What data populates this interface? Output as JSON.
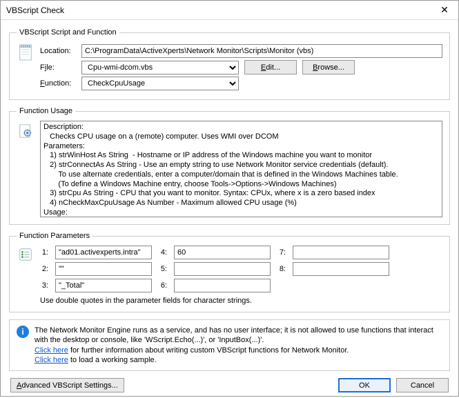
{
  "window": {
    "title": "VBScript Check",
    "close": "✕"
  },
  "scriptFn": {
    "legend": "VBScript Script and Function",
    "locationLabel": "Location:",
    "locationValue": "C:\\ProgramData\\ActiveXperts\\Network Monitor\\Scripts\\Monitor (vbs)",
    "fileLabelPlain": "F",
    "fileLabelUnderline": "i",
    "fileLabelRest": "le:",
    "fileValue": "Cpu-wmi-dcom.vbs",
    "edit": "Edit...",
    "editUnderline": "E",
    "browse": "owse...",
    "browseUnderline": "B",
    "browsePrefix": "r",
    "functionLabelUnderline": "F",
    "functionLabelRest": "unction:",
    "functionValue": "CheckCpuUsage"
  },
  "usage": {
    "legend": "Function Usage",
    "text": "Description:\n   Checks CPU usage on a (remote) computer. Uses WMI over DCOM\nParameters:\n   1) strWinHost As String  - Hostname or IP address of the Windows machine you want to monitor\n   2) strConnectAs As String - Use an empty string to use Network Monitor service credentials (default).\n       To use alternate credentials, enter a computer/domain that is defined in the Windows Machines table.\n       (To define a Windows Machine entry, choose Tools->Options->Windows Machines)\n   3) strCpu As String - CPU that you want to monitor. Syntax: CPUx, where x is a zero based index\n   4) nCheckMaxCpuUsage As Number - Maximum allowed CPU usage (%)\nUsage:\n   CheckCpuUsage( \"<Hostname | IP>\", \"<Empty String | Connect As>\", \"<_Total|0|1|...>\", <Max_Cpu_Percent> )\nSample:"
  },
  "params": {
    "legend": "Function Parameters",
    "labels": {
      "p1": "1:",
      "p2": "2:",
      "p3": "3:",
      "p4": "4:",
      "p5": "5:",
      "p6": "6:",
      "p7": "7:",
      "p8": "8:"
    },
    "values": {
      "p1": "\"ad01.activexperts.intra\"",
      "p2": "\"\"",
      "p3": "\"_Total\"",
      "p4": "60",
      "p5": "",
      "p6": "",
      "p7": "",
      "p8": ""
    },
    "hint": "Use double quotes in the parameter fields for character strings."
  },
  "info": {
    "line1a": "The Network Monitor Engine runs as a service, and has no user interface; it is not allowed to use functions that interact with the desktop or console, like 'WScript.Echo(...)', or 'InputBox(...)'.",
    "click": "Click here",
    "line2rest": " for further information about writing custom VBScript functions for Network Monitor.",
    "line3rest": " to load a working sample."
  },
  "bottom": {
    "advancedUnderline": "A",
    "advancedRest": "dvanced VBScript Settings...",
    "ok": "OK",
    "cancel": "Cancel"
  }
}
